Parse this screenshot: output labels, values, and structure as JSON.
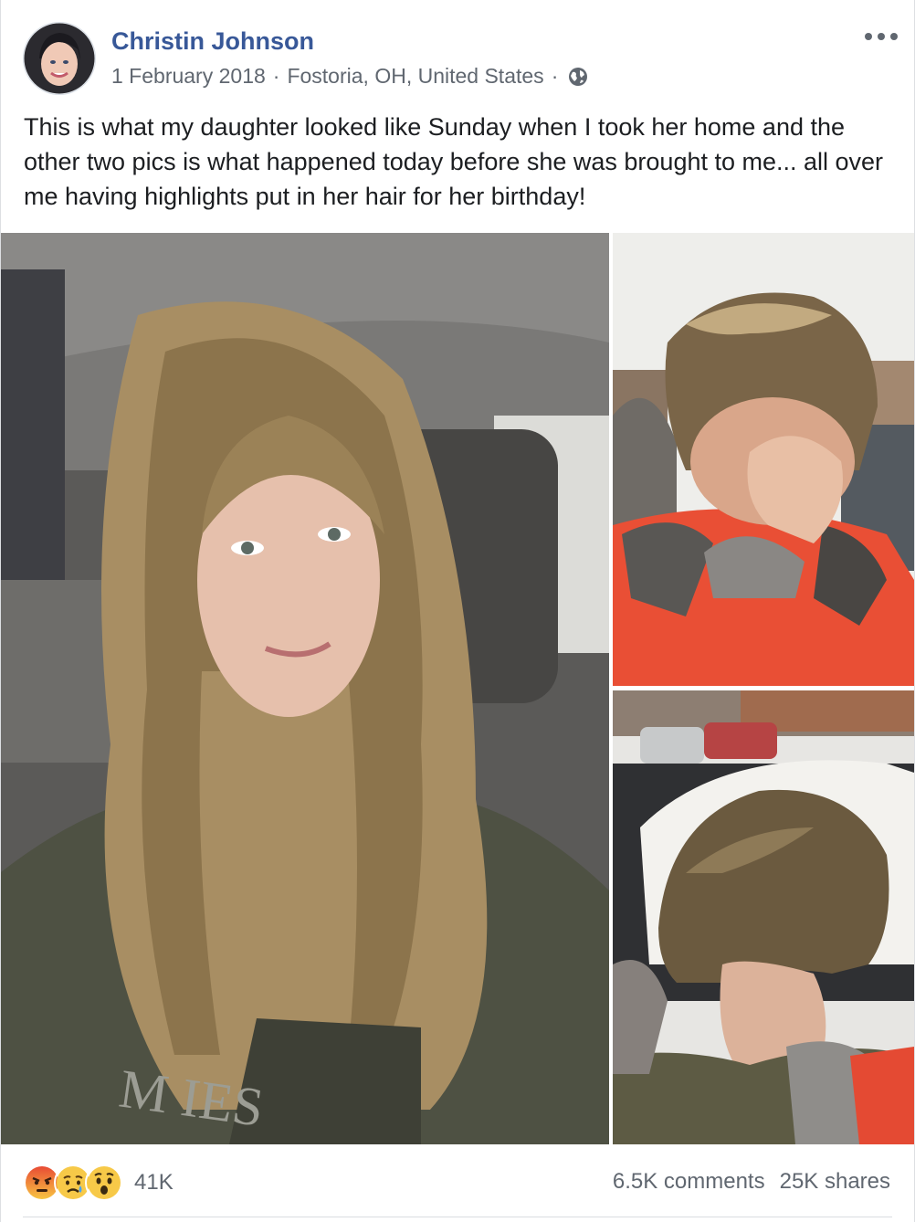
{
  "post": {
    "author": "Christin Johnson",
    "date": "1 February 2018",
    "separator": "·",
    "location": "Fostoria, OH, United States",
    "privacy_icon": "globe-icon",
    "more_icon": "more-options-icon",
    "text": "This is what my daughter looked like Sunday when I took her home and the other two pics is what happened today before she was brought to me... all over me having highlights put in her hair for her birthday!",
    "photos": [
      {
        "name": "photo-long-hair-selfie"
      },
      {
        "name": "photo-crying-short-hair"
      },
      {
        "name": "photo-back-of-head-short-hair"
      }
    ]
  },
  "footer": {
    "reaction_icons": [
      "angry-reaction-icon",
      "sad-reaction-icon",
      "wow-reaction-icon"
    ],
    "reaction_count": "41K",
    "comments": "6.5K comments",
    "shares": "25K shares"
  },
  "colors": {
    "author_link": "#385898",
    "meta_text": "#606770",
    "body_text": "#1c1e21"
  }
}
